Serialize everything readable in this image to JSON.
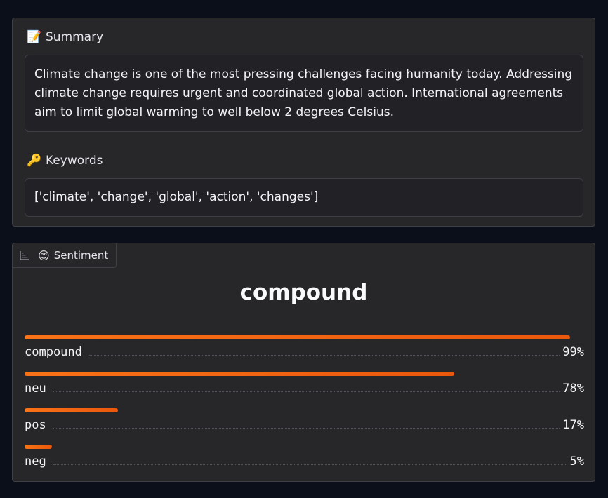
{
  "summary": {
    "label": "Summary",
    "emoji": "📝",
    "text": "Climate change is one of the most pressing challenges facing humanity today. Addressing climate change requires urgent and coordinated global action. International agreements aim to limit global warming to well below 2 degrees Celsius."
  },
  "keywords": {
    "label": "Keywords",
    "emoji": "🔑",
    "text": "['climate', 'change', 'global', 'action', 'changes']"
  },
  "sentiment": {
    "tab_label": "Sentiment",
    "tab_emoji": "😊",
    "title": "compound",
    "colors": {
      "bar_start": "#f97316",
      "bar_end": "#ea580c"
    },
    "items": [
      {
        "label": "compound",
        "value": 0.99,
        "display": "99%"
      },
      {
        "label": "neu",
        "value": 0.78,
        "display": "78%"
      },
      {
        "label": "pos",
        "value": 0.17,
        "display": "17%"
      },
      {
        "label": "neg",
        "value": 0.05,
        "display": "5%"
      }
    ]
  }
}
